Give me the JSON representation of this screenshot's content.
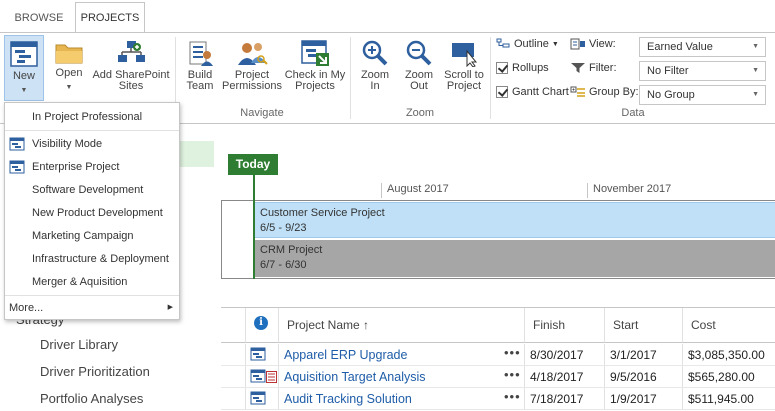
{
  "tabs": [
    {
      "label": "BROWSE",
      "active": false
    },
    {
      "label": "PROJECTS",
      "active": true
    }
  ],
  "ribbon": {
    "new": {
      "label": "New"
    },
    "open": {
      "label": "Open"
    },
    "add_sharepoint": {
      "label_line1": "Add SharePoint",
      "label_line2": "Sites"
    },
    "build_team": {
      "label_line1": "Build",
      "label_line2": "Team"
    },
    "project_permissions": {
      "label_line1": "Project",
      "label_line2": "Permissions"
    },
    "check_in": {
      "label_line1": "Check in My",
      "label_line2": "Projects"
    },
    "zoom_in": {
      "label_line1": "Zoom",
      "label_line2": "In"
    },
    "zoom_out": {
      "label_line1": "Zoom",
      "label_line2": "Out"
    },
    "scroll_to_project": {
      "label_line1": "Scroll to",
      "label_line2": "Project"
    },
    "outline": {
      "label": "Outline"
    },
    "rollups": {
      "label": "Rollups",
      "checked": true
    },
    "gantt_chart": {
      "label": "Gantt Chart",
      "checked": true
    },
    "view": {
      "label": "View:",
      "value": "Earned Value"
    },
    "filter": {
      "label": "Filter:",
      "value": "No Filter"
    },
    "group_by": {
      "label": "Group By:",
      "value": "No Group"
    },
    "groups": {
      "navigate": "Navigate",
      "zoom": "Zoom",
      "data": "Data"
    }
  },
  "new_menu": {
    "items": [
      {
        "label": "In Project Professional",
        "icon": ""
      },
      {
        "label": "Visibility Mode",
        "icon": "project-template-icon"
      },
      {
        "label": "Enterprise Project",
        "icon": "project-template-icon"
      },
      {
        "label": "Software Development",
        "icon": ""
      },
      {
        "label": "New Product Development",
        "icon": ""
      },
      {
        "label": "Marketing Campaign",
        "icon": ""
      },
      {
        "label": "Infrastructure & Deployment",
        "icon": ""
      },
      {
        "label": "Merger & Aquisition",
        "icon": ""
      }
    ],
    "more": "More..."
  },
  "left_nav": {
    "partial_item": "Strategy",
    "items": [
      "Driver Library",
      "Driver Prioritization",
      "Portfolio Analyses"
    ]
  },
  "timeline": {
    "today_label": "Today",
    "months": [
      "August 2017",
      "November 2017"
    ],
    "bars": [
      {
        "name": "Customer Service Project",
        "dates": "6/5 - 9/23"
      },
      {
        "name": "CRM Project",
        "dates": "6/7 - 6/30"
      }
    ]
  },
  "grid": {
    "columns": {
      "project_name": "Project Name ↑",
      "finish": "Finish",
      "start": "Start",
      "cost": "Cost"
    },
    "rows": [
      {
        "name": "Apparel ERP Upgrade",
        "finish": "8/30/2017",
        "start": "3/1/2017",
        "cost": "$3,085,350.00",
        "dots": "•••"
      },
      {
        "name": "Aquisition Target Analysis",
        "finish": "4/18/2017",
        "start": "9/5/2016",
        "cost": "$565,280.00",
        "dots": "•••"
      },
      {
        "name": "Audit Tracking Solution",
        "finish": "7/18/2017",
        "start": "1/9/2017",
        "cost": "$511,945.00",
        "dots": "•••"
      }
    ]
  },
  "colors": {
    "today_green": "#2e7d32",
    "bar_blue": "#bfe0f7",
    "bar_gray": "#a6a6a6",
    "link_blue": "#1f5da8",
    "new_btn_highlight": "#cde3f5"
  }
}
